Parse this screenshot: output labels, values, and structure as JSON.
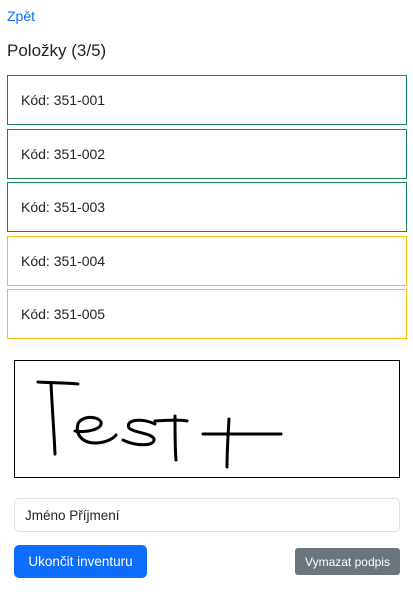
{
  "nav": {
    "back_label": "Zpět"
  },
  "header": {
    "title": "Položky (3/5)"
  },
  "items": [
    {
      "label": "Kód: 351-001",
      "status": "done",
      "color": "#198754"
    },
    {
      "label": "Kód: 351-002",
      "status": "done",
      "color": "#198754"
    },
    {
      "label": "Kód: 351-003",
      "status": "done",
      "color": "#198754"
    },
    {
      "label": "Kód: 351-004",
      "status": "pending",
      "color": "#ffc107"
    },
    {
      "label": "Kód: 351-005",
      "status": "pending",
      "color": "#ffc107"
    }
  ],
  "signature": {
    "handwritten_text": "Test"
  },
  "form": {
    "name_value": "Jméno Příjmení"
  },
  "actions": {
    "finish_label": "Ukončit inventuru",
    "clear_label": "Vymazat podpis"
  },
  "colors": {
    "primary": "#0d6efd",
    "secondary": "#6c757d",
    "success": "#198754",
    "warning": "#ffc107"
  }
}
